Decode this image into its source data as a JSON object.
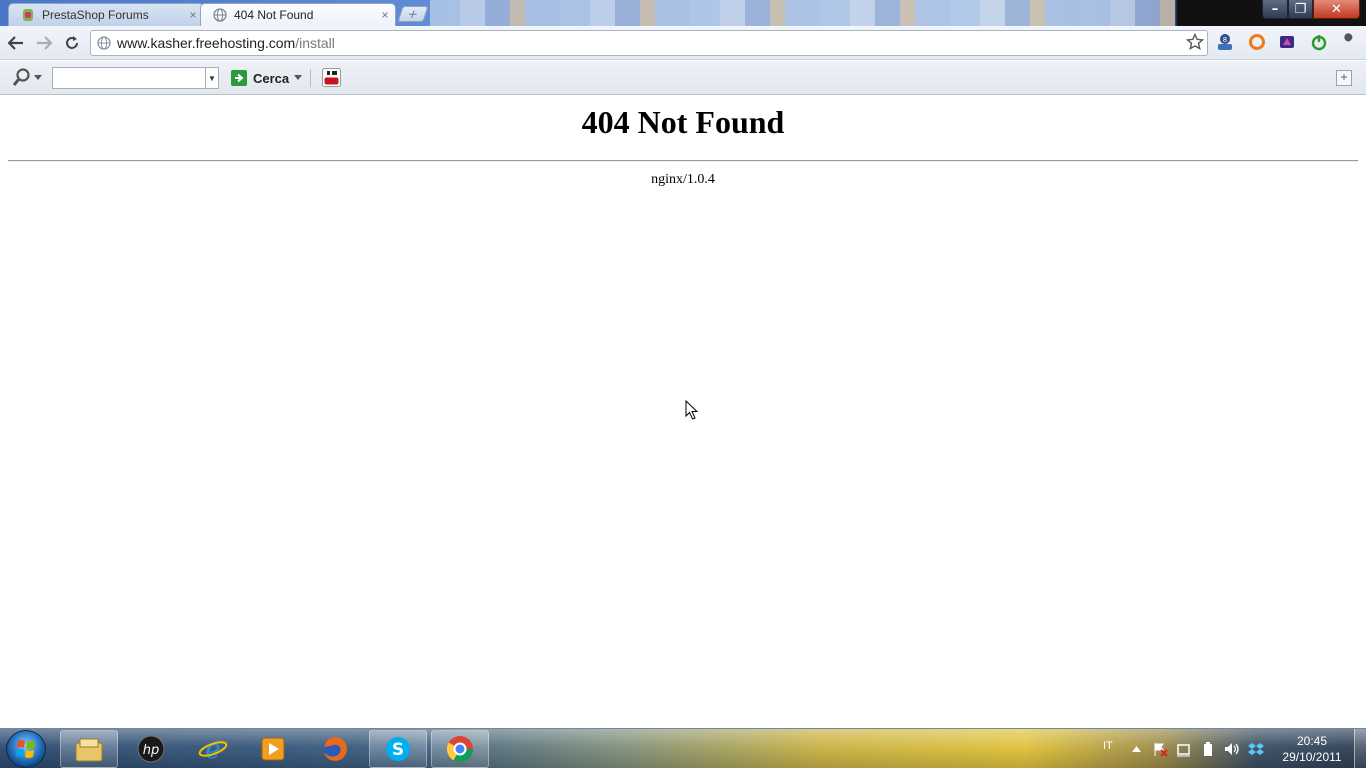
{
  "browser": {
    "tabs": [
      {
        "label": "PrestaShop Forums",
        "active": false
      },
      {
        "label": "404 Not Found",
        "active": true
      }
    ],
    "tab_close_glyph": "×",
    "new_tab_glyph": "+",
    "window_controls": {
      "minimize": "–",
      "maximize": "❐",
      "close": "✕"
    }
  },
  "navigation": {
    "url_host": "www.kasher.freehosting.com",
    "url_path": "/install",
    "icons": [
      "back-icon",
      "forward-icon",
      "reload-icon",
      "page-globe-icon",
      "bookmark-star-icon",
      "wrench-icon"
    ]
  },
  "toolbar": {
    "search_value": "",
    "search_button_label": "Cerca",
    "add_button_glyph": "+",
    "icons": [
      "search-icon",
      "youtube-icon"
    ]
  },
  "page": {
    "title": "404 Not Found",
    "server_signature": "nginx/1.0.4"
  },
  "taskbar": {
    "language": "IT",
    "clock_time": "20:45",
    "clock_date": "29/10/2011",
    "apps": [
      "windows-explorer-icon",
      "hp-icon",
      "internet-explorer-icon",
      "media-player-icon",
      "firefox-icon",
      "skype-icon",
      "chrome-icon"
    ]
  },
  "colors": {
    "page_background": "#ffffff",
    "page_text": "#000000",
    "taskbar_accent": "#e0c23b",
    "window_close": "#c2391f"
  }
}
